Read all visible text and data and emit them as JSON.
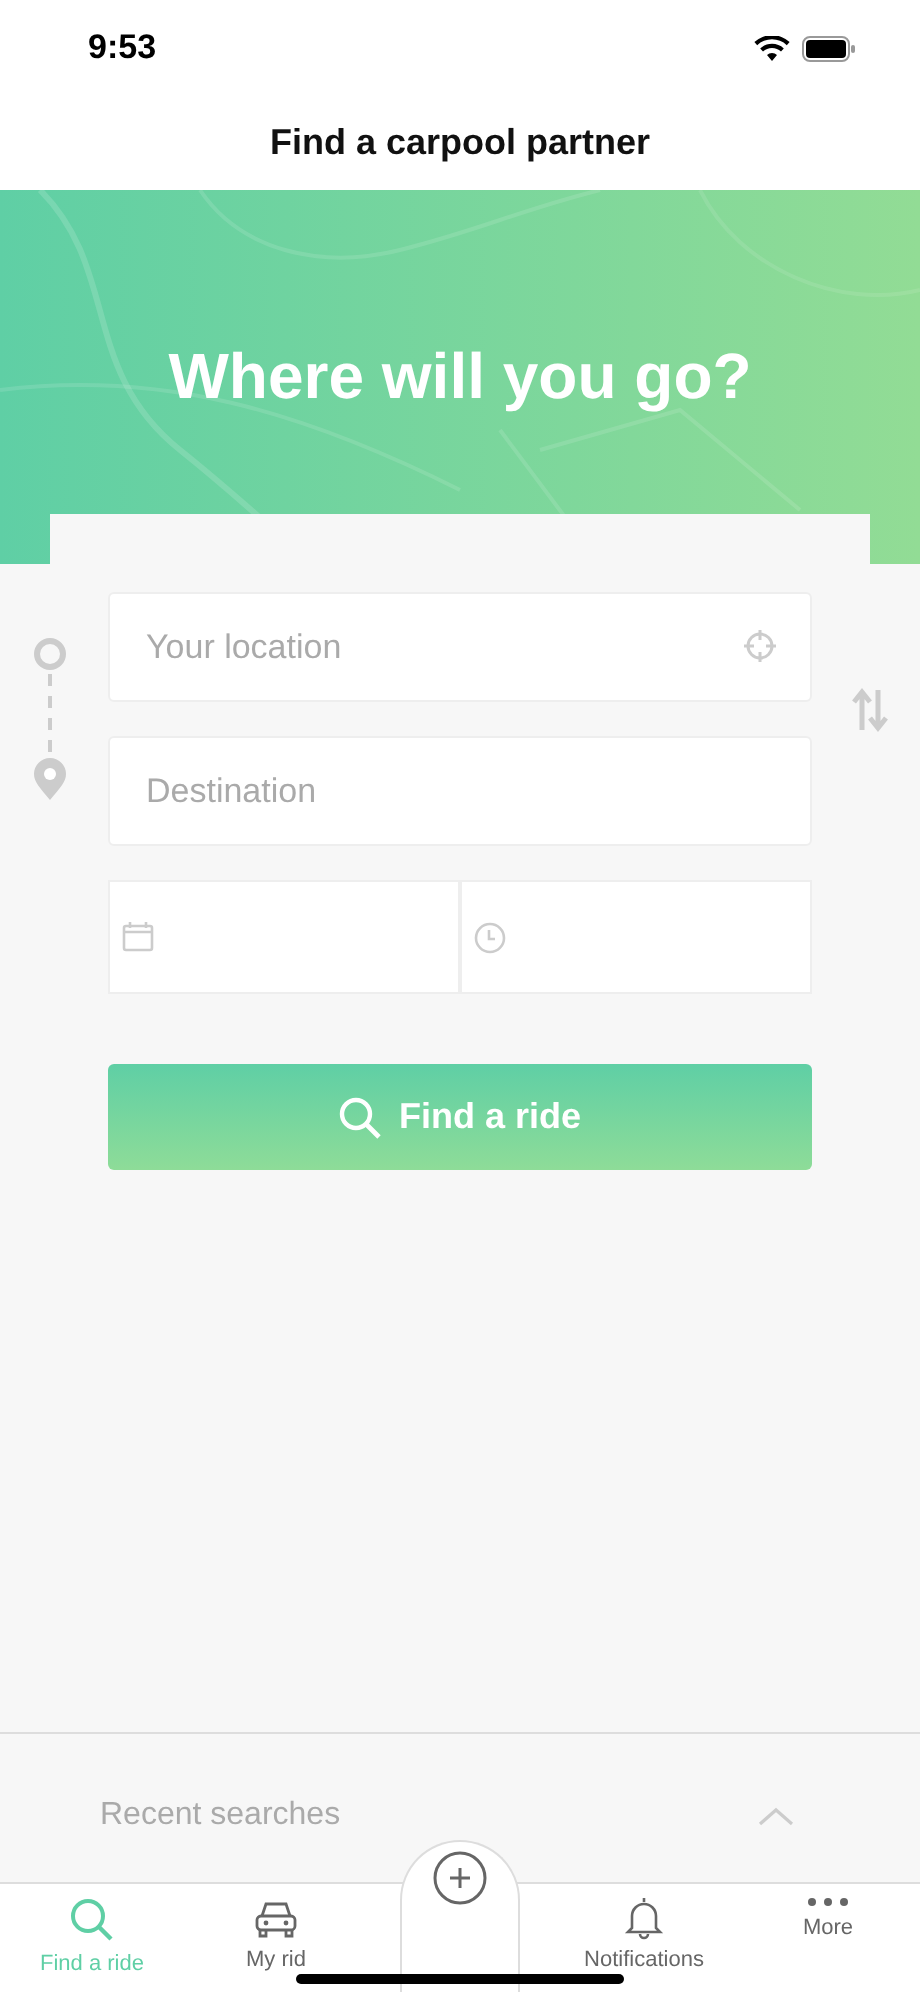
{
  "status_bar": {
    "time": "9:53"
  },
  "title": "Find a carpool partner",
  "hero": {
    "heading": "Where will you go?"
  },
  "form": {
    "location": {
      "placeholder": "Your location"
    },
    "destination": {
      "placeholder": "Destination"
    },
    "button": "Find a ride"
  },
  "recent_searches": {
    "label": "Recent searches",
    "expanded": false
  },
  "tabs": [
    {
      "label": "Find a ride",
      "kind": "search",
      "selected": true
    },
    {
      "label": "My rid",
      "kind": "car",
      "selected": false
    },
    {
      "kind": "create",
      "selected": false
    },
    {
      "label": "Notifications",
      "kind": "bell",
      "selected": false
    },
    {
      "label": "More",
      "kind": "more",
      "selected": false
    }
  ]
}
